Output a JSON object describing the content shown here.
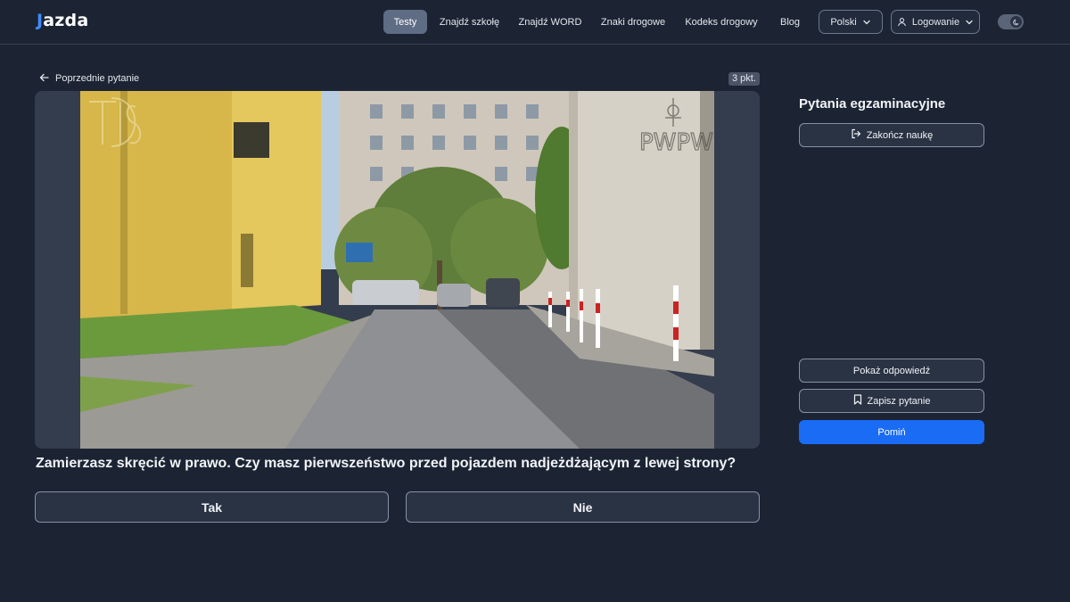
{
  "header": {
    "logo_mark": "J",
    "logo_text": "azda",
    "nav": [
      {
        "label": "Testy",
        "active": true
      },
      {
        "label": "Znajdź szkołę",
        "active": false
      },
      {
        "label": "Znajdź WORD",
        "active": false
      },
      {
        "label": "Znaki drogowe",
        "active": false
      },
      {
        "label": "Kodeks drogowy",
        "active": false
      },
      {
        "label": "Blog",
        "active": false
      }
    ],
    "language": {
      "label": "Polski",
      "icon": "chevron-down-icon"
    },
    "login": {
      "label": "Logowanie",
      "icon": "user-icon"
    },
    "theme_toggle": {
      "icon": "moon-icon"
    }
  },
  "question_panel": {
    "back_label": "Poprzednie pytanie",
    "points": "3 pkt.",
    "media": {
      "watermark_left": "ITS",
      "watermark_right": "PWPW"
    },
    "question_text": "Zamierzasz skręcić w prawo. Czy masz pierwszeństwo przed pojazdem nadjeżdżającym z lewej strony?",
    "answers": [
      "Tak",
      "Nie"
    ]
  },
  "sidebar": {
    "title": "Pytania egzaminacyjne",
    "end_study": {
      "label": "Zakończ naukę",
      "icon": "logout-icon"
    },
    "show_answer": {
      "label": "Pokaż odpowiedź"
    },
    "save_question": {
      "label": "Zapisz pytanie",
      "icon": "bookmark-icon"
    },
    "skip": {
      "label": "Pomiń"
    }
  },
  "colors": {
    "background": "#1c2433",
    "accent": "#1a6cf5",
    "nav_active": "#5e6c84"
  }
}
